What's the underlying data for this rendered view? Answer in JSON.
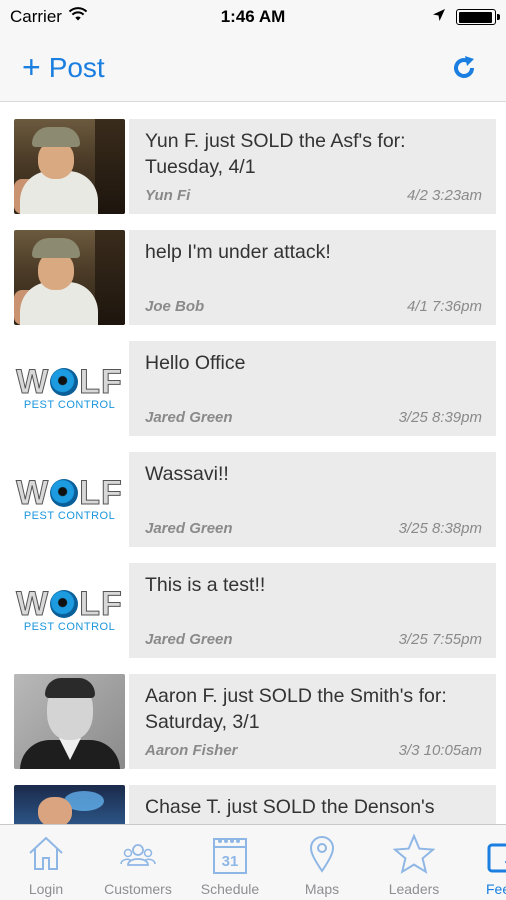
{
  "status_bar": {
    "carrier": "Carrier",
    "time": "1:46 AM",
    "battery_level": 0.95
  },
  "nav": {
    "post_plus": "+",
    "post_label": "Post",
    "refresh_icon": "refresh-icon",
    "accent_color": "#1a7fe0"
  },
  "feed": {
    "items": [
      {
        "message": "Yun F. just SOLD the Asf's for: Tuesday, 4/1",
        "author": "Yun Fi",
        "time": "4/2 3:23am",
        "avatar": "photo-cap"
      },
      {
        "message": "help I'm under attack!",
        "author": "Joe Bob",
        "time": "4/1 7:36pm",
        "avatar": "photo-cap"
      },
      {
        "message": "Hello Office",
        "author": "Jared Green",
        "time": "3/25 8:39pm",
        "avatar": "wolf-logo"
      },
      {
        "message": "Wassavi!!",
        "author": "Jared Green",
        "time": "3/25 8:38pm",
        "avatar": "wolf-logo"
      },
      {
        "message": "This is a test!!",
        "author": "Jared Green",
        "time": "3/25 7:55pm",
        "avatar": "wolf-logo"
      },
      {
        "message": "Aaron F. just SOLD the Smith's for: Saturday, 3/1",
        "author": "Aaron Fisher",
        "time": "3/3 10:05am",
        "avatar": "photo-suit"
      },
      {
        "message": "Chase T. just SOLD the Denson's",
        "author": "",
        "time": "",
        "avatar": "photo-blue"
      }
    ],
    "card_color": "#ebebeb"
  },
  "wolf_logo": {
    "w1": "W",
    "o_part": "LF",
    "sub": "PEST CONTROL"
  },
  "tabs": [
    {
      "label": "Login",
      "icon": "home-icon"
    },
    {
      "label": "Customers",
      "icon": "people-icon"
    },
    {
      "label": "Schedule",
      "icon": "calendar-icon",
      "calendar_day": "31"
    },
    {
      "label": "Maps",
      "icon": "map-pin-icon"
    },
    {
      "label": "Leaders",
      "icon": "star-icon"
    },
    {
      "label": "Feed",
      "icon": "feed-icon",
      "active": true
    }
  ]
}
